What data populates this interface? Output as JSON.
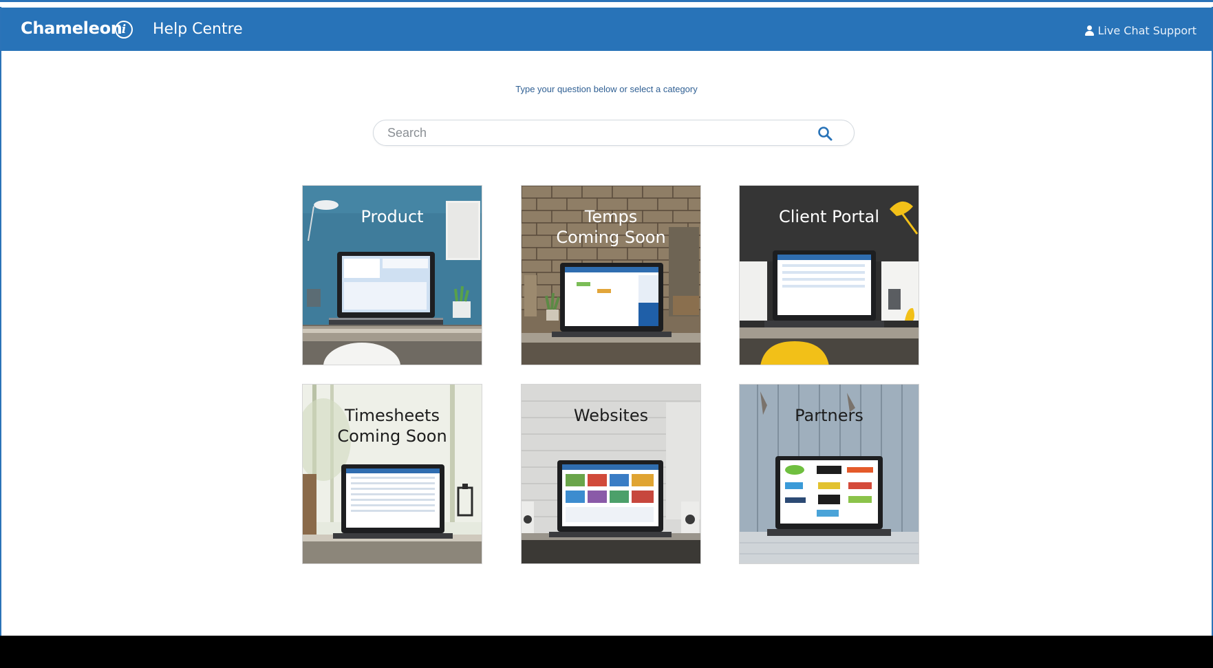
{
  "header": {
    "brand": "Chameleon",
    "brand_icon": "info-circle-icon",
    "section": "Help Centre",
    "live_chat_label": "Live Chat Support",
    "live_chat_icon": "user-icon",
    "bar_color": "#2873b8"
  },
  "search": {
    "prompt": "Type your question below or select a category",
    "placeholder": "Search",
    "value": "",
    "button_icon": "search-icon"
  },
  "categories": [
    {
      "label": "Product"
    },
    {
      "label": "Temps\nComing Soon"
    },
    {
      "label": "Client Portal"
    },
    {
      "label": "Timesheets\nComing Soon"
    },
    {
      "label": "Websites"
    },
    {
      "label": "Partners"
    }
  ]
}
